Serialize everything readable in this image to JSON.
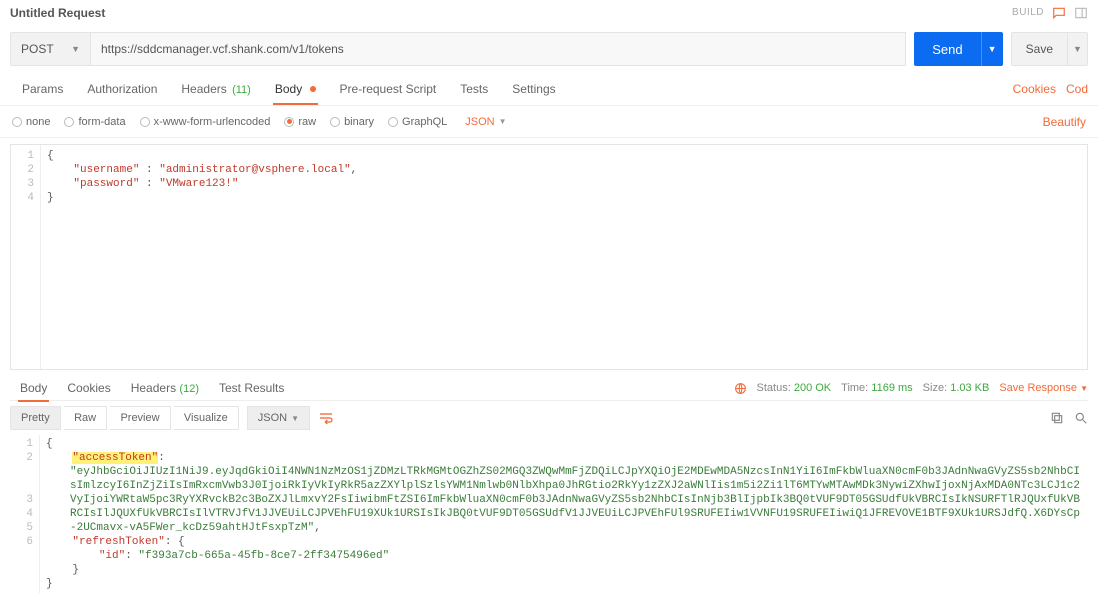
{
  "header": {
    "title": "Untitled Request",
    "build": "BUILD"
  },
  "request": {
    "method": "POST",
    "url": "https://sddcmanager.vcf.shank.com/v1/tokens",
    "send": "Send",
    "save": "Save"
  },
  "tabs": {
    "params": "Params",
    "auth": "Authorization",
    "headers_label": "Headers",
    "headers_count": "(11)",
    "body": "Body",
    "prescript": "Pre-request Script",
    "tests": "Tests",
    "settings": "Settings",
    "cookies": "Cookies",
    "code": "Cod"
  },
  "body_type": {
    "none": "none",
    "formdata": "form-data",
    "xwww": "x-www-form-urlencoded",
    "raw": "raw",
    "binary": "binary",
    "graphql": "GraphQL",
    "format": "JSON",
    "beautify": "Beautify"
  },
  "request_body": {
    "line1": "{",
    "line2_k": "\"username\"",
    "line2_v": "\"administrator@vsphere.local\"",
    "line3_k": "\"password\"",
    "line3_v": "\"VMware123!\"",
    "line4": "}"
  },
  "response_tabs": {
    "body": "Body",
    "cookies": "Cookies",
    "headers_label": "Headers",
    "headers_count": "(12)",
    "test_results": "Test Results"
  },
  "response_meta": {
    "status_lbl": "Status:",
    "status_val": "200 OK",
    "time_lbl": "Time:",
    "time_val": "1169 ms",
    "size_lbl": "Size:",
    "size_val": "1.03 KB",
    "save_response": "Save Response"
  },
  "response_toolbar": {
    "pretty": "Pretty",
    "raw": "Raw",
    "preview": "Preview",
    "visualize": "Visualize",
    "format": "JSON"
  },
  "response_body": {
    "line1": "{",
    "access_key": "\"accessToken\"",
    "access_val": "\"eyJhbGciOiJIUzI1NiJ9.eyJqdGkiOiI4NWN1NzMzOS1jZDMzLTRkMGMtOGZhZS02MGQ3ZWQwMmFjZDQiLCJpYXQiOjE2MDEwMDA5NzcsInN1YiI6ImFkbWluaXN0cmF0b3JAdnNwaGVyZS5sb2NhbCIsImlzcyI6InZjZiIsImRxcmVwb3J0IjoiRkIyVkIyRkR5azZXYlplSzlsYWM1Nmlwb0NlbXhpa0JhRGtio2RkYy1zZXJ2aWNlIis1m5i2Zi1lT6MTYwMTAwMDk3NywiZXhwIjoxNjAxMDA0NTc3LCJ1c2VyIjoiYWRtaW5pc3RyYXRvckB2c3BoZXJlLmxvY2FsIiwibmFtZSI6ImFkbWluaXN0cmF0b3JAdnNwaGVyZS5sb2NhbCIsInNjb3BlIjpbIk3BQ0tVUF9DT05GSUdfUkVBRCIsIkNSURFTlRJQUxfUkVBRCIsIlJQUXfUkVBRCIsIlVTRVJfV1JJVEUiLCJPVEhFU19XUk1URSIsIkJBQ0tVUF9DT05GSUdfV1JJVEUiLCJPVEhFUl9SRUFEIiw1VVNFU19SRUFEIiwiQ1JFREVOVE1BTF9XUk1URSJdfQ.X6DYsCp-2UCmavx-vA5FWer_kcDz59ahtHJtFsxpTzM\"",
    "refresh_key": "\"refreshToken\"",
    "id_key": "\"id\"",
    "id_val": "\"f393a7cb-665a-45fb-8ce7-2ff3475496ed\"",
    "line5": "}",
    "line6": "}"
  }
}
